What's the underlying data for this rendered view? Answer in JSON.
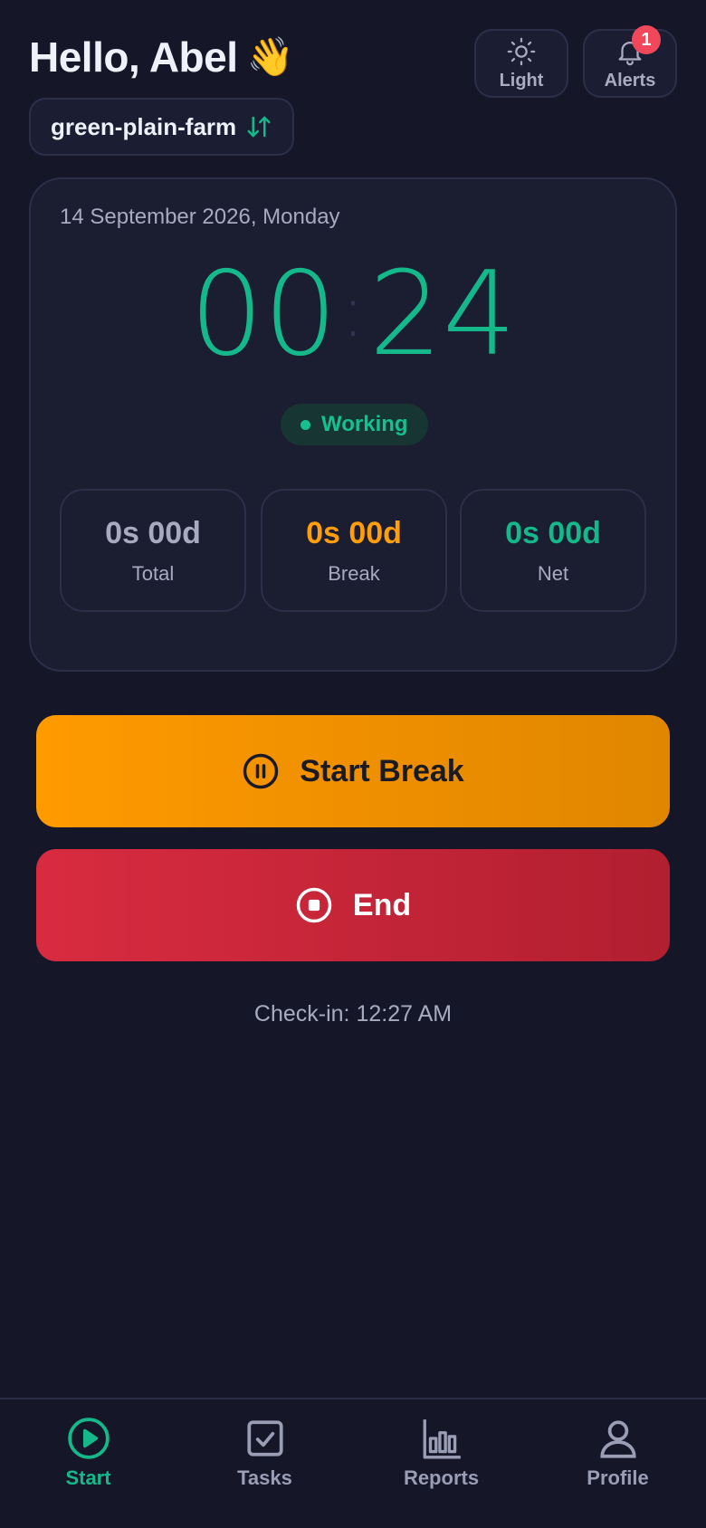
{
  "header": {
    "greeting": "Hello, Abel",
    "greeting_emoji": "👋",
    "farm_name": "green-plain-farm",
    "theme_button_label": "Light",
    "alerts_button_label": "Alerts",
    "alerts_count": "1"
  },
  "timer": {
    "date": "14 September 2026, Monday",
    "minutes": "00",
    "seconds": "24",
    "status": "Working",
    "stats": [
      {
        "value": "0s 00d",
        "caption": "Total",
        "color": "#a7abc0"
      },
      {
        "value": "0s 00d",
        "caption": "Break",
        "color": "#ff9d0a"
      },
      {
        "value": "0s 00d",
        "caption": "Net",
        "color": "#14b88a"
      }
    ]
  },
  "actions": {
    "start_break_label": "Start Break",
    "end_label": "End",
    "checkin_text": "Check-in: 12:27 AM"
  },
  "nav": {
    "items": [
      {
        "label": "Start",
        "icon": "play-circle-icon",
        "active": true
      },
      {
        "label": "Tasks",
        "icon": "checkbox-icon",
        "active": false
      },
      {
        "label": "Reports",
        "icon": "bar-chart-icon",
        "active": false
      },
      {
        "label": "Profile",
        "icon": "user-icon",
        "active": false
      }
    ]
  },
  "colors": {
    "background": "#151729",
    "accent_green": "#14b88a",
    "break_orange": "#ff9a00",
    "end_red": "#d92b40",
    "badge_red": "#f0485a"
  }
}
